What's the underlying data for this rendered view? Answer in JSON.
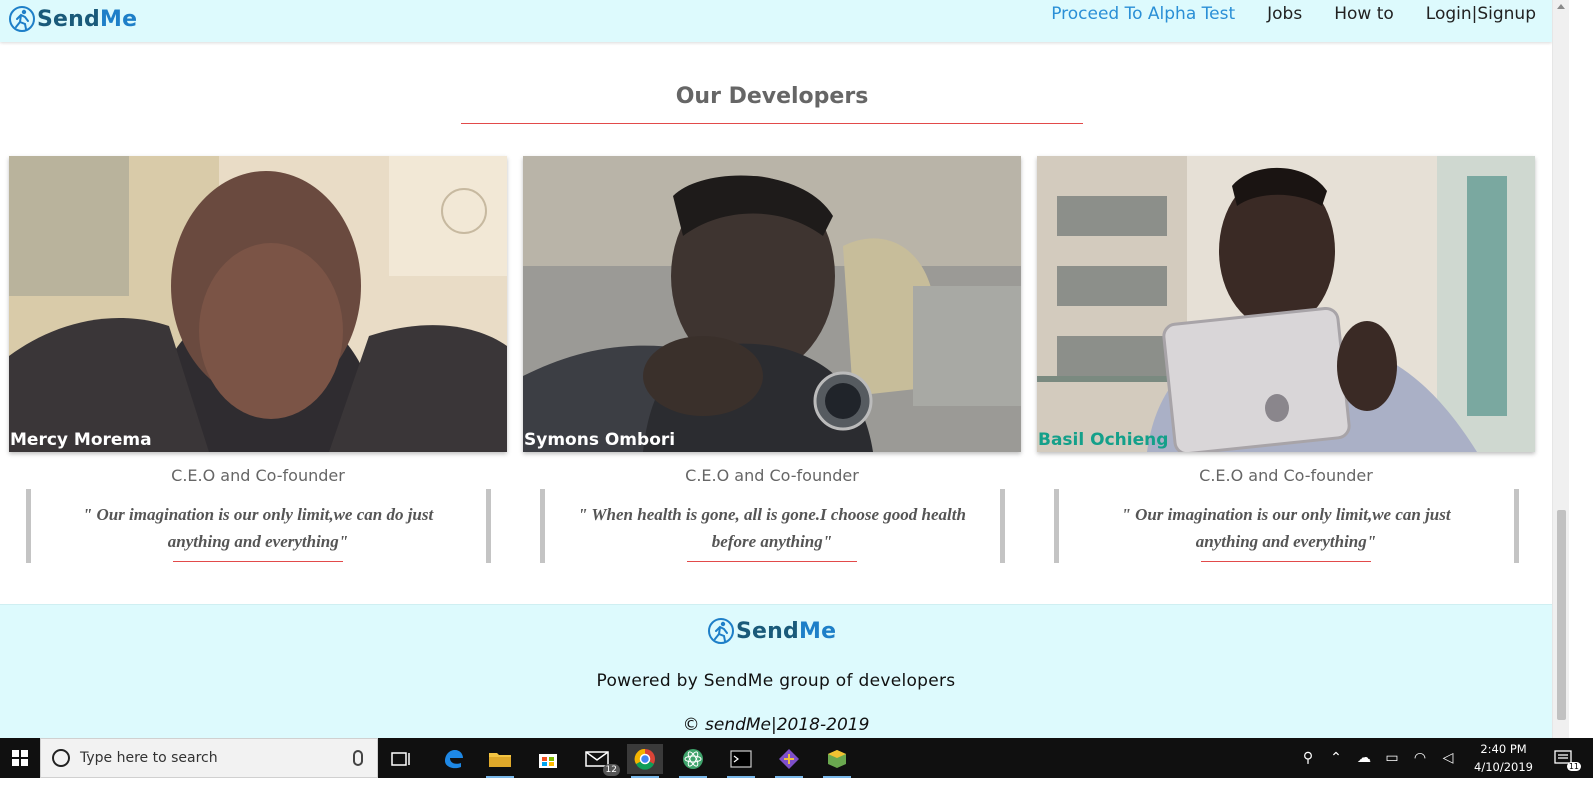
{
  "nav": {
    "brand_prefix": "Send",
    "brand_suffix": "Me",
    "links": [
      "Proceed To Alpha Test",
      "Jobs",
      "How to",
      "Login|Signup"
    ]
  },
  "section": {
    "title": "Our Developers"
  },
  "developers": [
    {
      "name": "Mercy Morema",
      "role": "C.E.O and Co-founder",
      "quote": "\" Our imagination is our only limit,we can do just anything and everything\""
    },
    {
      "name": "Symons Ombori",
      "role": "C.E.O and Co-founder",
      "quote": "\" When health is gone, all is gone.I choose good health before anything\""
    },
    {
      "name": "Basil Ochieng",
      "role": "C.E.O and Co-founder",
      "quote": "\" Our imagination is our only limit,we can just anything and everything\""
    }
  ],
  "footer": {
    "brand_prefix": "Send",
    "brand_suffix": "Me",
    "powered": "Powered by SendMe group of developers",
    "copyright": "© sendMe|2018-2019"
  },
  "taskbar": {
    "search_placeholder": "Type here to search",
    "mail_badge": "12",
    "time": "2:40 PM",
    "date": "4/10/2019",
    "notification_count": "11"
  },
  "colors": {
    "header_bg": "#ddfafd",
    "accent_link": "#2a8fd6",
    "rule_red": "#e24a4a",
    "name_teal": "#14a08a"
  }
}
